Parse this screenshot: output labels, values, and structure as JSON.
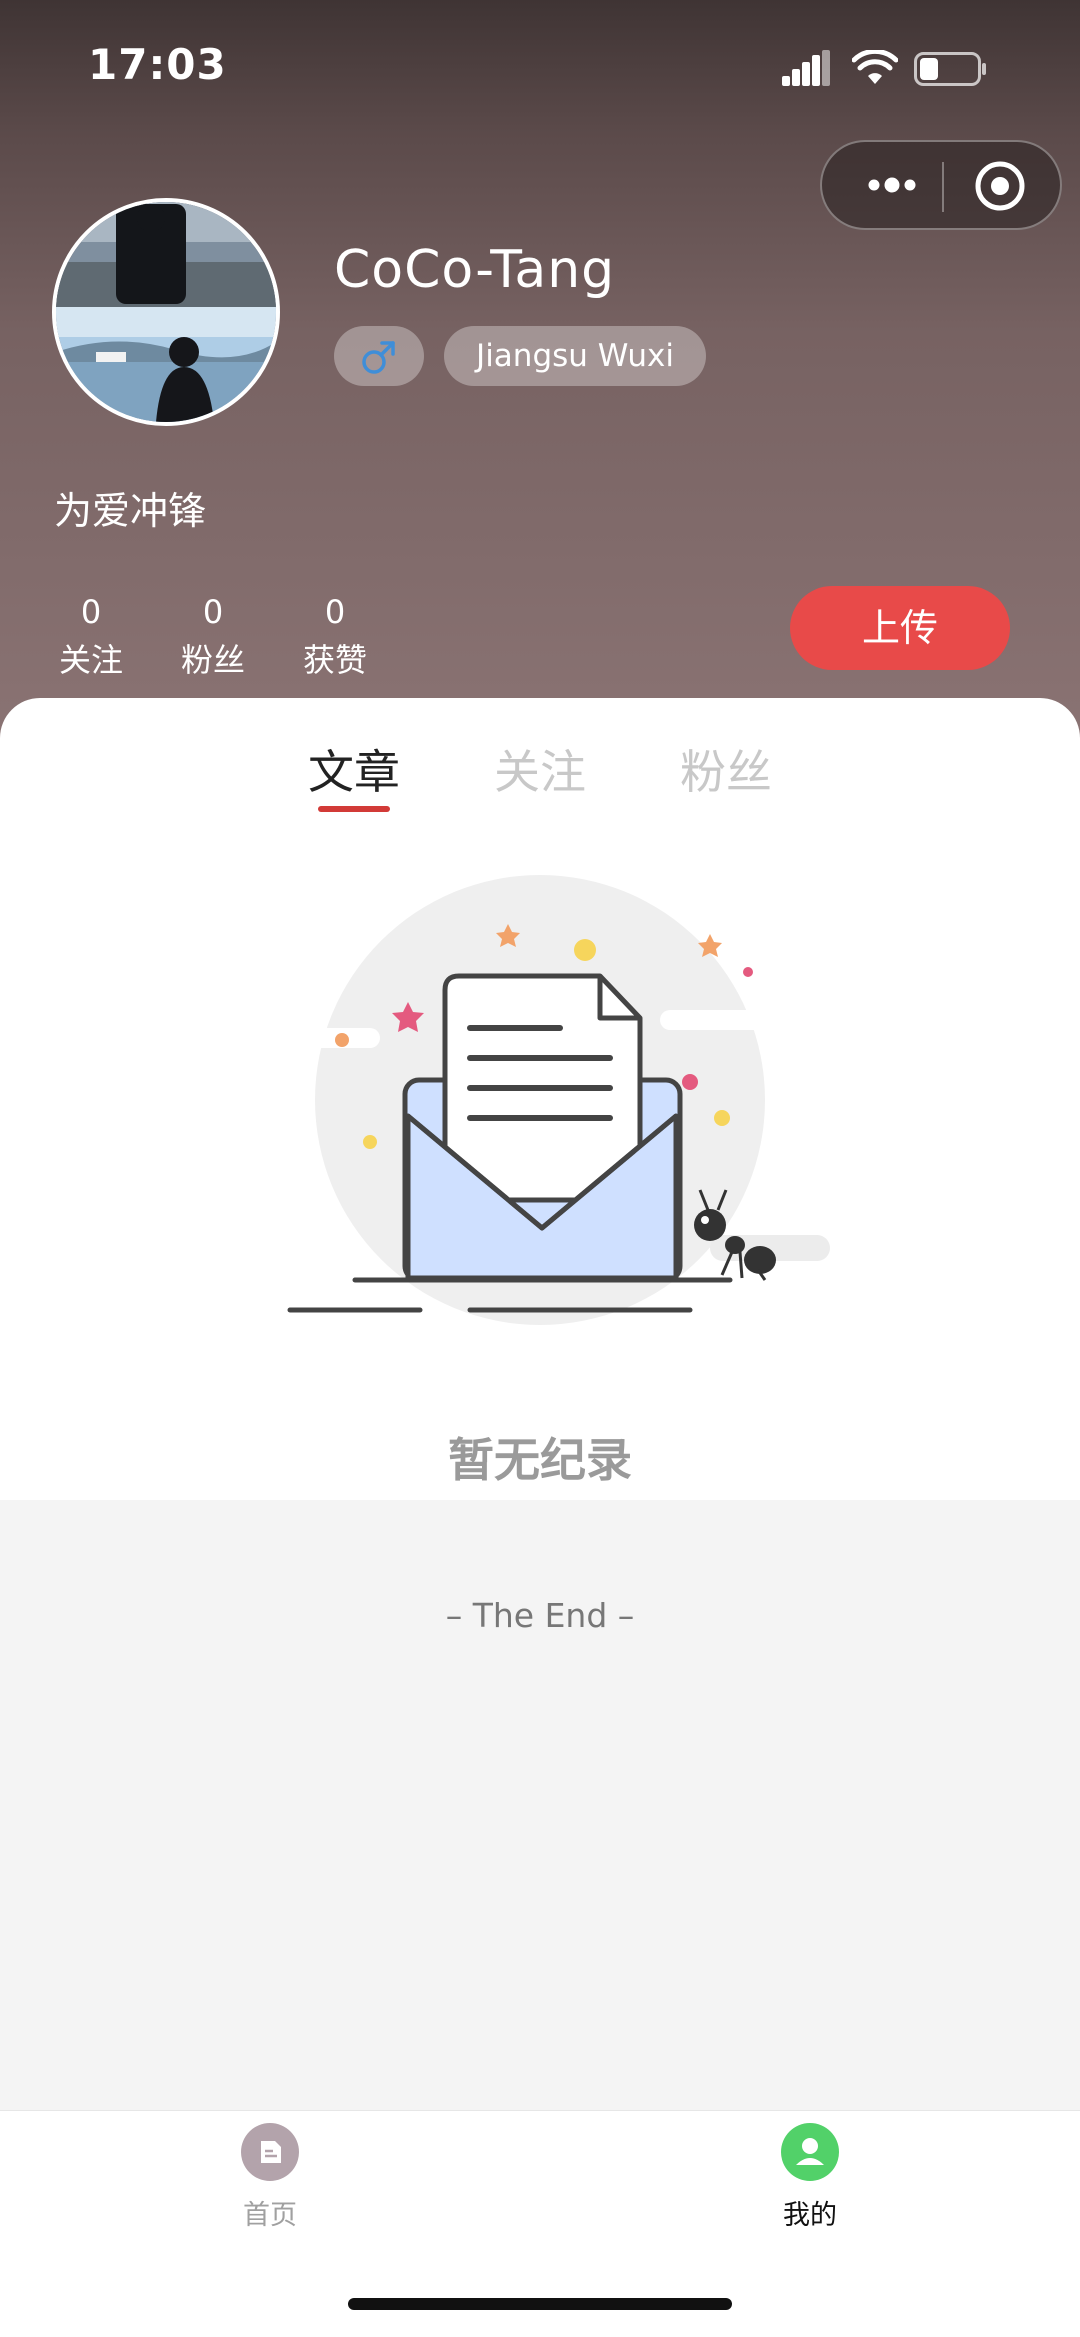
{
  "status_bar": {
    "time": "17:03",
    "icons": [
      "signal-icon",
      "wifi-icon",
      "battery-icon"
    ]
  },
  "capsule": {
    "icons": [
      "more-icon",
      "close-circle-icon"
    ]
  },
  "profile": {
    "username": "CoCo-Tang",
    "gender_symbol": "♂",
    "location": "Jiangsu Wuxi",
    "bio": "为爱冲锋",
    "stats": [
      {
        "value": "0",
        "label": "关注"
      },
      {
        "value": "0",
        "label": "粉丝"
      },
      {
        "value": "0",
        "label": "获赞"
      }
    ],
    "upload_label": "上传"
  },
  "tabs": [
    {
      "label": "文章",
      "active": true
    },
    {
      "label": "关注",
      "active": false
    },
    {
      "label": "粉丝",
      "active": false
    }
  ],
  "empty_state": {
    "text": "暂无纪录",
    "icon": "empty-mailbox-illustration"
  },
  "footer_text": "– The End –",
  "tabbar": [
    {
      "label": "首页",
      "icon": "home-icon",
      "active": false
    },
    {
      "label": "我的",
      "icon": "user-icon",
      "active": true
    }
  ],
  "colors": {
    "accent": "#e84a49",
    "tab_indicator": "#d23a37",
    "active_tab_icon": "#52d169"
  }
}
